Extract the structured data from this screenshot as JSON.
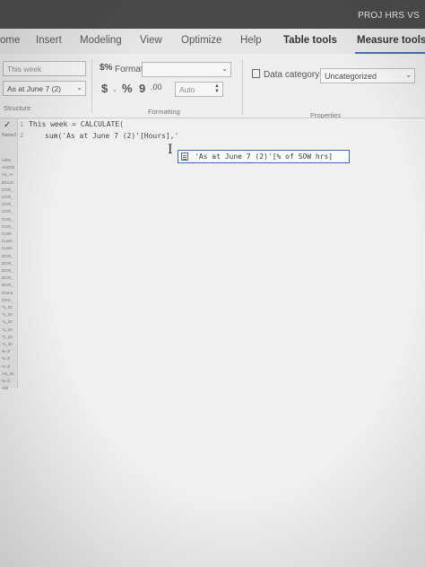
{
  "window": {
    "title": "PROJ HRS VS"
  },
  "menu": {
    "tabs": [
      {
        "label": "ome"
      },
      {
        "label": "Insert"
      },
      {
        "label": "Modeling"
      },
      {
        "label": "View"
      },
      {
        "label": "Optimize"
      },
      {
        "label": "Help"
      },
      {
        "label": "Table tools"
      },
      {
        "label": "Measure tools"
      }
    ]
  },
  "ribbon": {
    "structure": {
      "name_value": "This week",
      "home_table_value": "As at June 7 (2)",
      "group_label": "Structure"
    },
    "formatting": {
      "format_label": "Format",
      "format_value": "",
      "currency_symbol": "$",
      "percent_symbol": "%",
      "comma_symbol": "9",
      "decimals_symbol": ".00",
      "decimal_places_value": "Auto",
      "group_label": "Formatting"
    },
    "properties": {
      "data_category_label": "Data category",
      "data_category_value": "Uncategorized",
      "group_label": "Properties"
    }
  },
  "editor": {
    "line1_number": "1",
    "line1_code": "This week = CALCULATE(",
    "line2_number": "2",
    "line2_code": "sum('As at June 7 (2)'[Hours],'",
    "autocomplete_text": "'As at June 7 (2)'[% of SOW hrs]",
    "left_panel_label": "Name2"
  },
  "field_list": {
    "items": [
      "Admi",
      "AUDIO",
      "A2_Ar",
      "BOUO",
      "COO_",
      "COO_",
      "COO_",
      "COO_",
      "COO_",
      "COO_",
      "Contr",
      "Custo",
      "Custo",
      "DOO_",
      "DOO_",
      "DOO_",
      "DOO_",
      "DOO_",
      "Overa",
      "OSS_",
      "*1_20",
      "*1_20",
      "*1_20",
      "*1_20",
      "*1_20",
      "*1_20",
      "% of",
      "% of",
      "% of",
      "AS_20",
      "% of",
      "otal"
    ]
  },
  "colors": {
    "accent": "#3d6fb1",
    "titlebar": "#4a4846",
    "background": "#ecebe9"
  }
}
